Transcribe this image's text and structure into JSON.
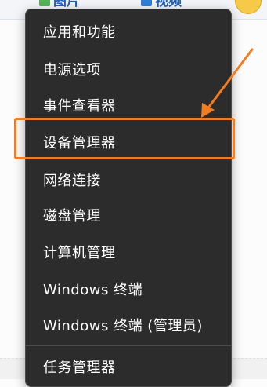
{
  "background": {
    "toolbar_items": [
      "图片",
      "视频"
    ]
  },
  "context_menu": {
    "items": [
      {
        "label": "应用和功能"
      },
      {
        "label": "电源选项"
      },
      {
        "label": "事件查看器"
      },
      {
        "label": "设备管理器"
      },
      {
        "label": "网络连接"
      },
      {
        "label": "磁盘管理"
      },
      {
        "label": "计算机管理"
      },
      {
        "label": "Windows 终端"
      },
      {
        "label": "Windows 终端 (管理员)"
      },
      {
        "label": "任务管理器"
      }
    ]
  },
  "annotation": {
    "highlighted_item": "设备管理器",
    "color": "#f47c20"
  },
  "colors": {
    "menu_background": "#2c2c2c",
    "menu_text": "#ffffff",
    "highlight": "#f47c20"
  }
}
